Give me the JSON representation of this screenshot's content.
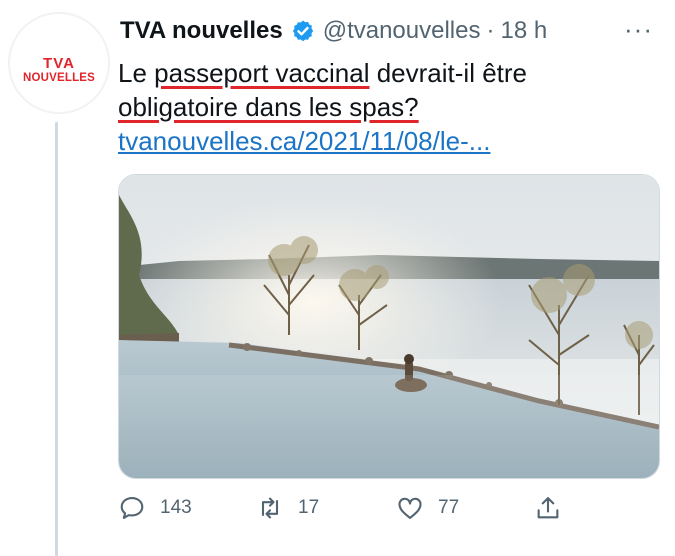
{
  "avatar": {
    "logo_top": "TVA",
    "logo_bottom": "NOUVELLES"
  },
  "header": {
    "name": "TVA nouvelles",
    "handle": "@tvanouvelles",
    "separator": "·",
    "time": "18 h",
    "more": "···"
  },
  "tweet": {
    "line1_pre": "Le ",
    "line1_ul": "passeport vaccinal",
    "line1_post": " devrait-il être",
    "line2_ul": "obligatoire dans les spas?",
    "link": "tvanouvelles.ca/2021/11/08/le-..."
  },
  "actions": {
    "reply_count": "143",
    "retweet_count": "17",
    "like_count": "77"
  },
  "colors": {
    "accent_link": "#1b74c5",
    "verified": "#1d9bf0",
    "underline": "#e0252b",
    "muted": "#536471"
  }
}
